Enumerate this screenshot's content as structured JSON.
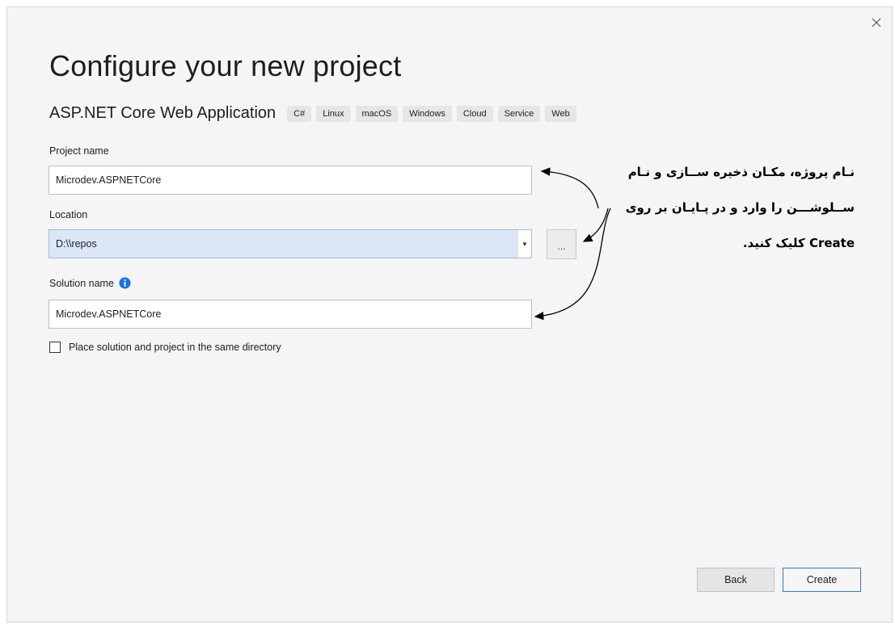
{
  "dialog": {
    "title": "Configure your new project",
    "template_name": "ASP.NET Core Web Application",
    "tags": [
      "C#",
      "Linux",
      "macOS",
      "Windows",
      "Cloud",
      "Service",
      "Web"
    ],
    "close_icon": "close-icon"
  },
  "form": {
    "project_name_label": "Project name",
    "project_name_value": "Microdev.ASPNETCore",
    "location_label": "Location",
    "location_value": "D:\\\\repos",
    "browse_label": "...",
    "solution_name_label": "Solution name",
    "solution_name_value": "Microdev.ASPNETCore",
    "info_icon": "info-icon",
    "same_directory_label": "Place solution and project in the same directory",
    "same_directory_checked": false
  },
  "buttons": {
    "back": "Back",
    "create": "Create"
  },
  "annotation": {
    "line1": "نـام پروژه، مکـان ذخیره ســازی و نـام",
    "line2": "ســلوشـــن را وارد  و در پـایـان بر روی",
    "line3": "Create کلیک کنید."
  },
  "colors": {
    "accent": "#3b78d6",
    "info": "#1a73e8"
  }
}
